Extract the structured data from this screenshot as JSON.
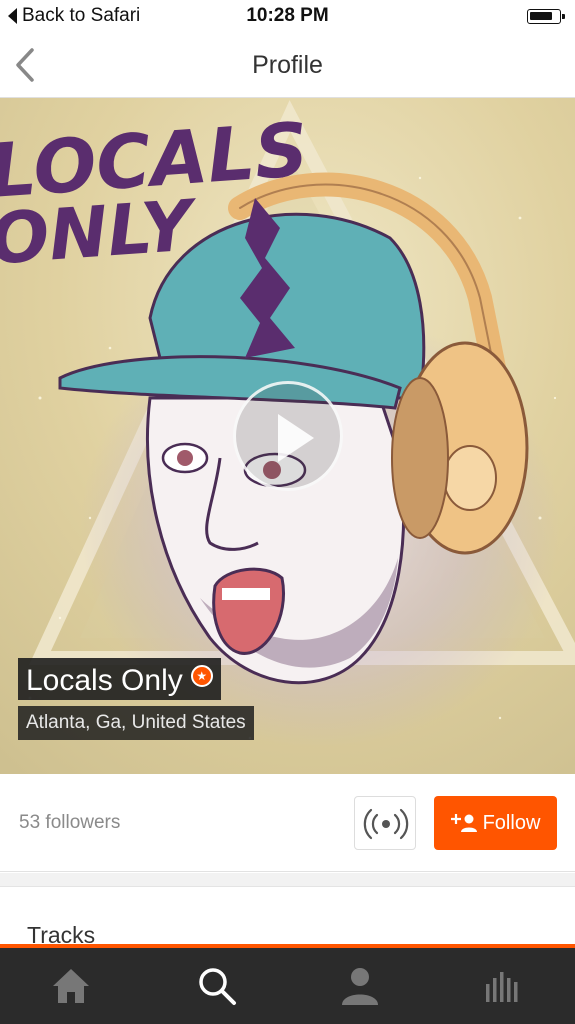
{
  "status_bar": {
    "back_label": "Back to Safari",
    "time": "10:28 PM",
    "battery_icon": "battery-icon"
  },
  "nav": {
    "title": "Profile",
    "back_icon": "chevron-left-icon"
  },
  "hero": {
    "artwork_text": [
      "LOCALS",
      "ONLY"
    ],
    "play_icon": "play-icon",
    "name": "Locals Only",
    "pro_badge_icon": "star-badge-icon",
    "location": "Atlanta, Ga, United States"
  },
  "stats": {
    "followers": "53 followers",
    "station_icon": "station-broadcast-icon",
    "follow_label": "Follow",
    "follow_icon": "add-user-icon"
  },
  "sections": {
    "tracks_title": "Tracks"
  },
  "tab_bar": {
    "items": [
      {
        "icon": "home-icon"
      },
      {
        "icon": "search-icon"
      },
      {
        "icon": "user-icon"
      },
      {
        "icon": "library-icon"
      }
    ]
  },
  "colors": {
    "accent": "#ff5500",
    "tab_bar_bg": "#2b2b2b",
    "hero_bg": "#e6d8a8"
  }
}
